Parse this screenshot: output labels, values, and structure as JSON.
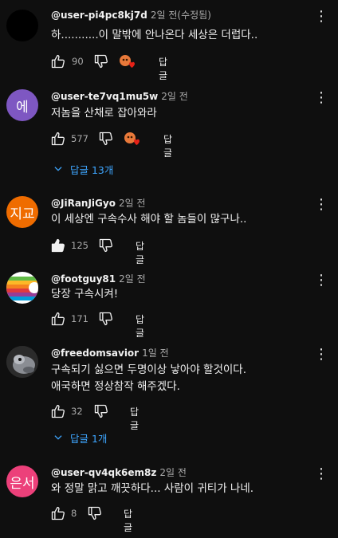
{
  "reply_label": "답글",
  "comments": [
    {
      "handle": "@user-pi4pc8kj7d",
      "time": "2일 전(수정됨)",
      "text_lines": [
        "하...........이 말밖에 안나온다 세상은 더럽다.."
      ],
      "likes": "90",
      "avatar_letter": "",
      "avatar_color": "#000000"
    },
    {
      "handle": "@user-te7vq1mu5w",
      "time": "2일 전",
      "text_lines": [
        "저놈을 산채로 잡아와라"
      ],
      "likes": "577",
      "avatar_letter": "에",
      "avatar_color": "#7e57c2",
      "replies_label": "답글 13개"
    },
    {
      "handle": "@JiRanJiGyo",
      "time": "2일 전",
      "text_lines": [
        "이 세상엔 구속수사 해야 할 놈들이 많구나.."
      ],
      "likes": "125",
      "avatar_letter": "지교",
      "avatar_color": "#ef6c00"
    },
    {
      "handle": "@footguy81",
      "time": "2일 전",
      "text_lines": [
        "당장 구속시켜!"
      ],
      "likes": "171",
      "avatar_letter": "",
      "avatar_color": "#ffffff"
    },
    {
      "handle": "@freedomsavior",
      "time": "1일 전",
      "text_lines": [
        "구속되기 싫으면 두명이상 낳아야 할것이다.",
        "애국하면 정상참작 해주겠다."
      ],
      "likes": "32",
      "avatar_letter": "",
      "avatar_color": "#2b2b2b",
      "replies_label": "답글 1개"
    },
    {
      "handle": "@user-qv4qk6em8z",
      "time": "2일 전",
      "text_lines": [
        "와 정말 맑고 깨끗하다... 사람이 귀티가 나네."
      ],
      "likes": "8",
      "avatar_letter": "은서",
      "avatar_color": "#ec407a"
    }
  ]
}
